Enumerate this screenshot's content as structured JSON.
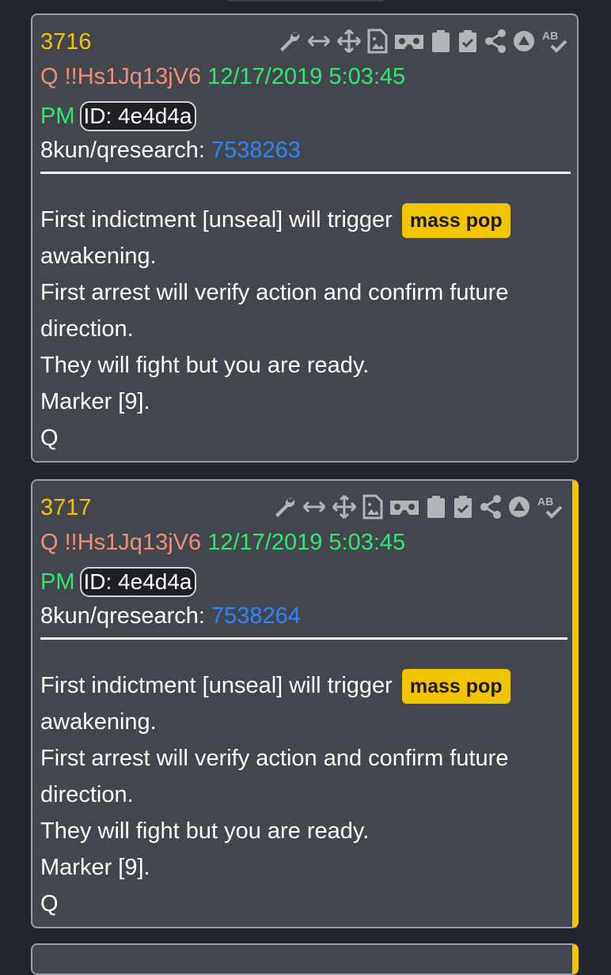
{
  "posts": [
    {
      "number": "3716",
      "author": "Q",
      "tripcode": "!!Hs1Jq13jV6",
      "date": "12/17/2019 5:03:45",
      "time_suffix": "PM",
      "id_label": "ID: 4e4d4a",
      "board": "8kun/qresearch:",
      "ref": "7538263",
      "body_line1": "First indictment [unseal] will trigger",
      "tag": "mass pop",
      "body_lines": [
        "awakening.",
        "First arrest will verify action and confirm future",
        "direction.",
        "They will fight but you are ready.",
        "Marker [9].",
        "Q"
      ]
    },
    {
      "number": "3717",
      "author": "Q",
      "tripcode": "!!Hs1Jq13jV6",
      "date": "12/17/2019 5:03:45",
      "time_suffix": "PM",
      "id_label": "ID: 4e4d4a",
      "board": "8kun/qresearch:",
      "ref": "7538264",
      "body_line1": "First indictment [unseal] will trigger",
      "tag": "mass pop",
      "body_lines": [
        "awakening.",
        "First arrest will verify action and confirm future",
        "direction.",
        "They will fight but you are ready.",
        "Marker [9].",
        "Q"
      ]
    }
  ],
  "toolbar_icons": [
    "wrench-icon",
    "resize-horizontal-icon",
    "move-icon",
    "image-file-icon",
    "vr-goggles-icon",
    "clipboard-icon",
    "clipboard-check-icon",
    "share-icon",
    "up-arrow-circle-icon",
    "spellcheck-icon"
  ],
  "colors": {
    "background": "#23252c",
    "card": "#44464d",
    "post_number": "#f3c400",
    "author": "#f08f79",
    "date": "#2ee872",
    "link": "#2a86ff",
    "tag": "#f3c400"
  }
}
